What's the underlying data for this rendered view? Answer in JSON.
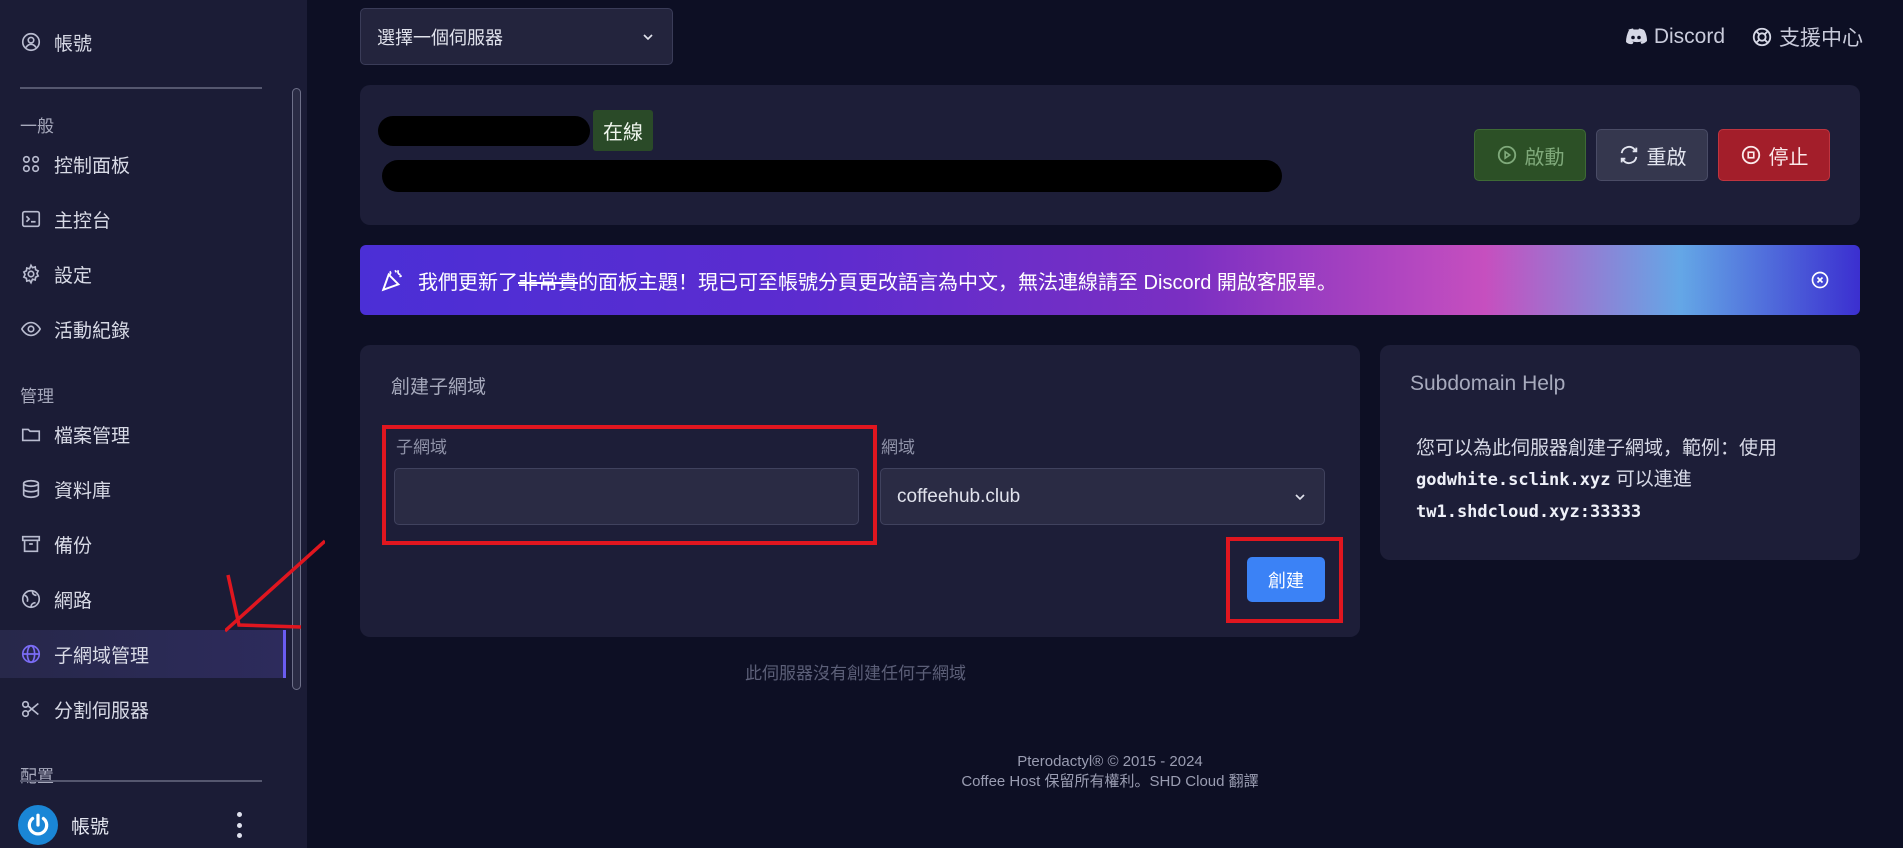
{
  "sidebar": {
    "account_top": "帳號",
    "section_general": "一般",
    "section_manage": "管理",
    "section_config": "配置",
    "items": [
      {
        "label": "控制面板",
        "icon": "dashboard-icon"
      },
      {
        "label": "主控台",
        "icon": "terminal-icon"
      },
      {
        "label": "設定",
        "icon": "gear-icon"
      },
      {
        "label": "活動紀錄",
        "icon": "eye-icon"
      },
      {
        "label": "檔案管理",
        "icon": "folder-icon"
      },
      {
        "label": "資料庫",
        "icon": "database-icon"
      },
      {
        "label": "備份",
        "icon": "archive-icon"
      },
      {
        "label": "網路",
        "icon": "network-icon"
      },
      {
        "label": "子網域管理",
        "icon": "globe-icon",
        "active": true
      },
      {
        "label": "分割伺服器",
        "icon": "scissors-icon"
      }
    ],
    "user_label": "帳號"
  },
  "header": {
    "server_select_label": "選擇一個伺服器",
    "discord_label": "Discord",
    "support_label": "支援中心"
  },
  "server": {
    "status": "在線",
    "btn_start": "啟動",
    "btn_restart": "重啟",
    "btn_stop": "停止"
  },
  "banner": {
    "text_before": "我們更新了",
    "text_strike": "非常貴",
    "text_after": "的面板主題！現已可至帳號分頁更改語言為中文，無法連線請至 Discord 開啟客服單。"
  },
  "create": {
    "title": "創建子網域",
    "subdomain_label": "子網域",
    "subdomain_value": "",
    "domain_label": "網域",
    "domain_selected": "coffeehub.club",
    "create_button": "創建",
    "empty_message": "此伺服器沒有創建任何子網域"
  },
  "help": {
    "title": "Subdomain Help",
    "text1": "您可以為此伺服器創建子網域，範例：使用",
    "example_domain": "godwhite.sclink.xyz",
    "text2": "可以連進",
    "example_target": "tw1.shdcloud.xyz:33333"
  },
  "footer": {
    "line1": "Pterodactyl® © 2015 - 2024",
    "line2": "Coffee Host 保留所有權利。SHD Cloud 翻譯"
  },
  "colors": {
    "accent": "#3b82f6",
    "active_nav": "#6a5cf0",
    "status_online": "#2a4a28",
    "stop": "#a31e2a",
    "annotation_red": "#e0161f"
  }
}
